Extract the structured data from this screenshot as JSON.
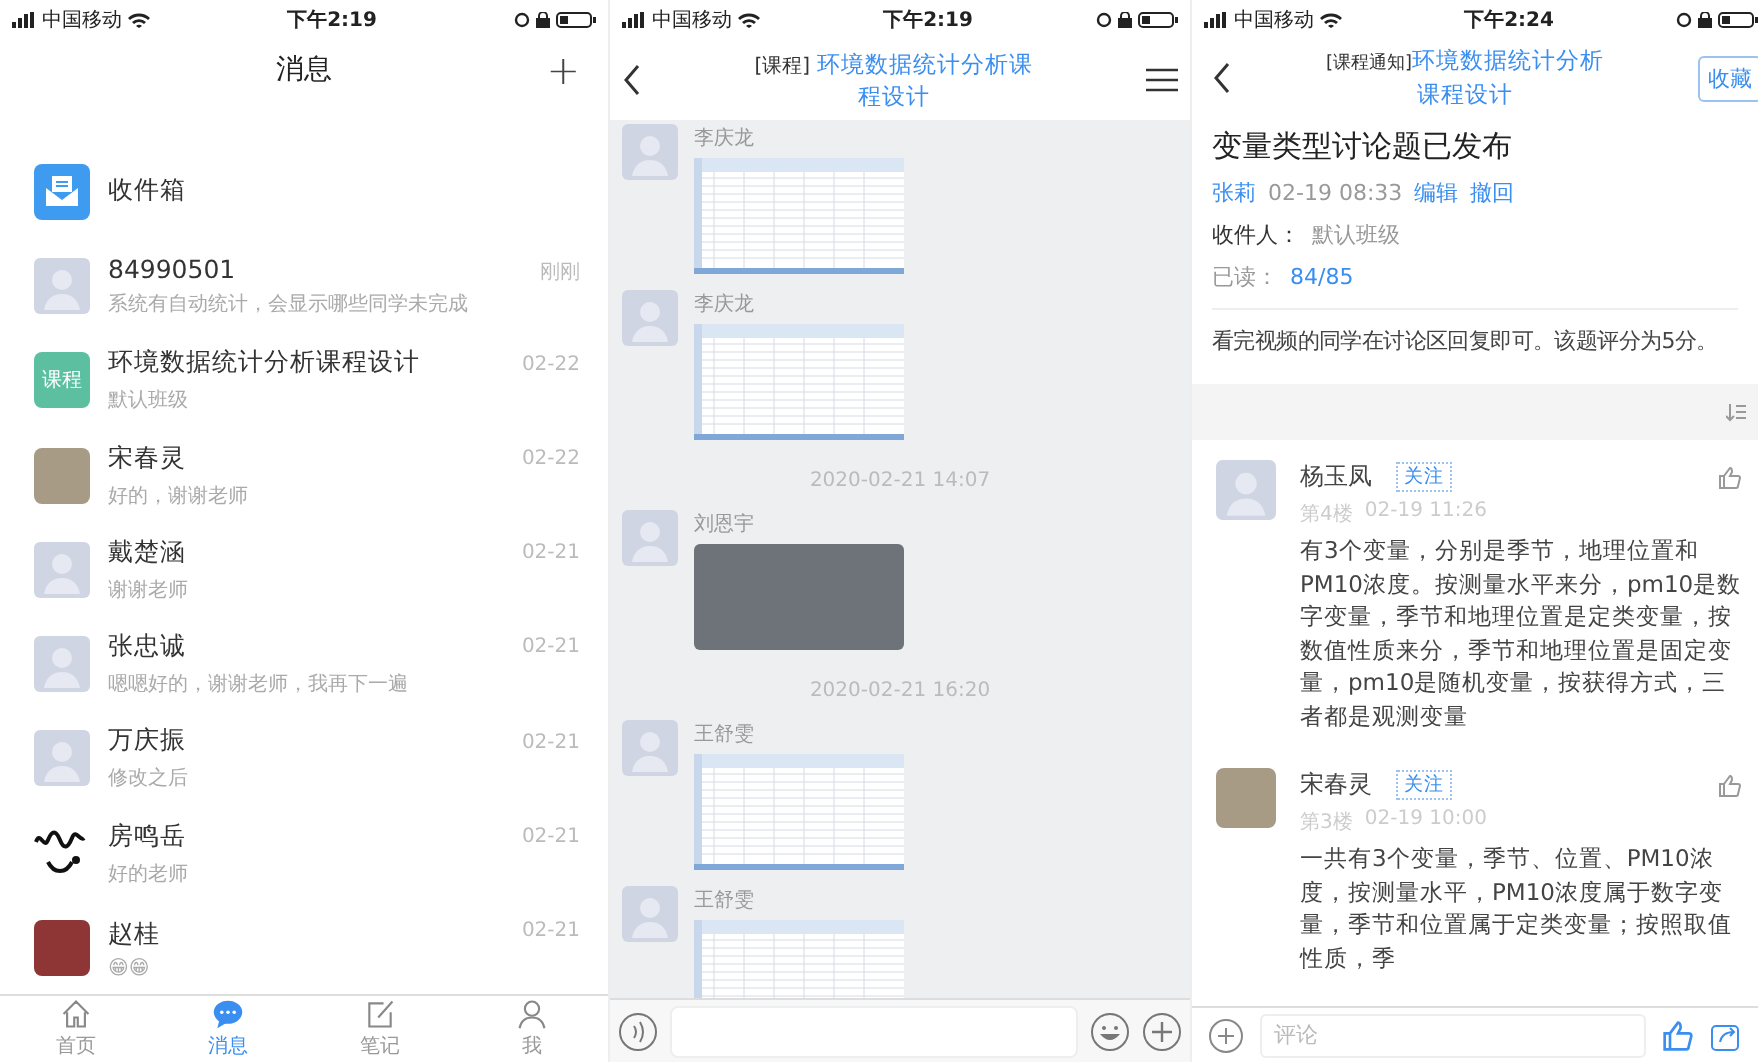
{
  "messages_screen": {
    "status_bar": {
      "carrier": "中国移动",
      "time": "下午2:19"
    },
    "title": "消息",
    "add_button": "+",
    "conversations": [
      {
        "kind": "inbox",
        "name": "收件箱"
      },
      {
        "kind": "placeholder",
        "name": "84990501",
        "time": "刚刚",
        "preview": "系统有自动统计，会显示哪些同学未完成"
      },
      {
        "kind": "course",
        "avatar_text": "课程",
        "name": "环境数据统计分析课程设计",
        "time": "02-22",
        "preview": "默认班级"
      },
      {
        "kind": "photo",
        "name": "宋春灵",
        "time": "02-22",
        "preview": "好的，谢谢老师"
      },
      {
        "kind": "placeholder",
        "name": "戴楚涵",
        "time": "02-21",
        "preview": "谢谢老师"
      },
      {
        "kind": "placeholder",
        "name": "张忠诚",
        "time": "02-21",
        "preview": "嗯嗯好的，谢谢老师，我再下一遍"
      },
      {
        "kind": "placeholder",
        "name": "万庆振",
        "time": "02-21",
        "preview": "修改之后"
      },
      {
        "kind": "doodle",
        "name": "房鸣岳",
        "time": "02-21",
        "preview": "好的老师"
      },
      {
        "kind": "art",
        "name": "赵桂",
        "time": "02-21",
        "preview": "😁😁"
      }
    ],
    "tabs": [
      {
        "label": "首页",
        "selected": false
      },
      {
        "label": "消息",
        "selected": true
      },
      {
        "label": "笔记",
        "selected": false
      },
      {
        "label": "我",
        "selected": false
      }
    ]
  },
  "chat_screen": {
    "status_bar": {
      "carrier": "中国移动",
      "time": "下午2:19"
    },
    "title_tag": "[课程]",
    "title": "环境数据统计分析课程设计",
    "items": [
      {
        "kind": "message",
        "sender": "李庆龙",
        "attachment": {
          "kind": "spreadsheet"
        }
      },
      {
        "kind": "message",
        "sender": "李庆龙",
        "attachment": {
          "kind": "spreadsheet"
        }
      },
      {
        "kind": "timestamp",
        "text": "2020-02-21 14:07"
      },
      {
        "kind": "message",
        "sender": "刘恩宇",
        "attachment": {
          "kind": "photo"
        }
      },
      {
        "kind": "timestamp",
        "text": "2020-02-21 16:20"
      },
      {
        "kind": "message",
        "sender": "王舒雯",
        "attachment": {
          "kind": "spreadsheet"
        }
      },
      {
        "kind": "message",
        "sender": "王舒雯",
        "attachment": {
          "kind": "spreadsheet"
        }
      }
    ]
  },
  "notice_screen": {
    "status_bar": {
      "carrier": "中国移动",
      "time": "下午2:24"
    },
    "title_tag": "[课程通知]",
    "title": "环境数据统计分析课程设计",
    "bookmark_button": "收藏",
    "notice": {
      "title": "变量类型讨论题已发布",
      "author": "张莉",
      "time": "02-19 08:33",
      "actions": [
        "编辑",
        "撤回"
      ],
      "recipient_label": "收件人：",
      "recipient": "默认班级",
      "read_label": "已读：",
      "read_count": "84/85",
      "body": "看完视频的同学在讨论区回复即可。该题评分为5分。"
    },
    "comments": [
      {
        "kind": "placeholder",
        "name": "杨玉凤",
        "follow": "关注",
        "floor": "第4楼",
        "time": "02-19 11:26",
        "text": "有3个变量，分别是季节，地理位置和PM10浓度。按测量水平来分，pm10是数字变量，季节和地理位置是定类变量，按数值性质来分，季节和地理位置是固定变量，pm10是随机变量，按获得方式，三者都是观测变量"
      },
      {
        "kind": "photo",
        "name": "宋春灵",
        "follow": "关注",
        "floor": "第3楼",
        "time": "02-19 10:00",
        "text": "一共有3个变量，季节、位置、PM10浓度，按测量水平，PM10浓度属于数字变量，季节和位置属于定类变量；按照取值性质，季"
      }
    ],
    "comment_placeholder": "评论"
  }
}
